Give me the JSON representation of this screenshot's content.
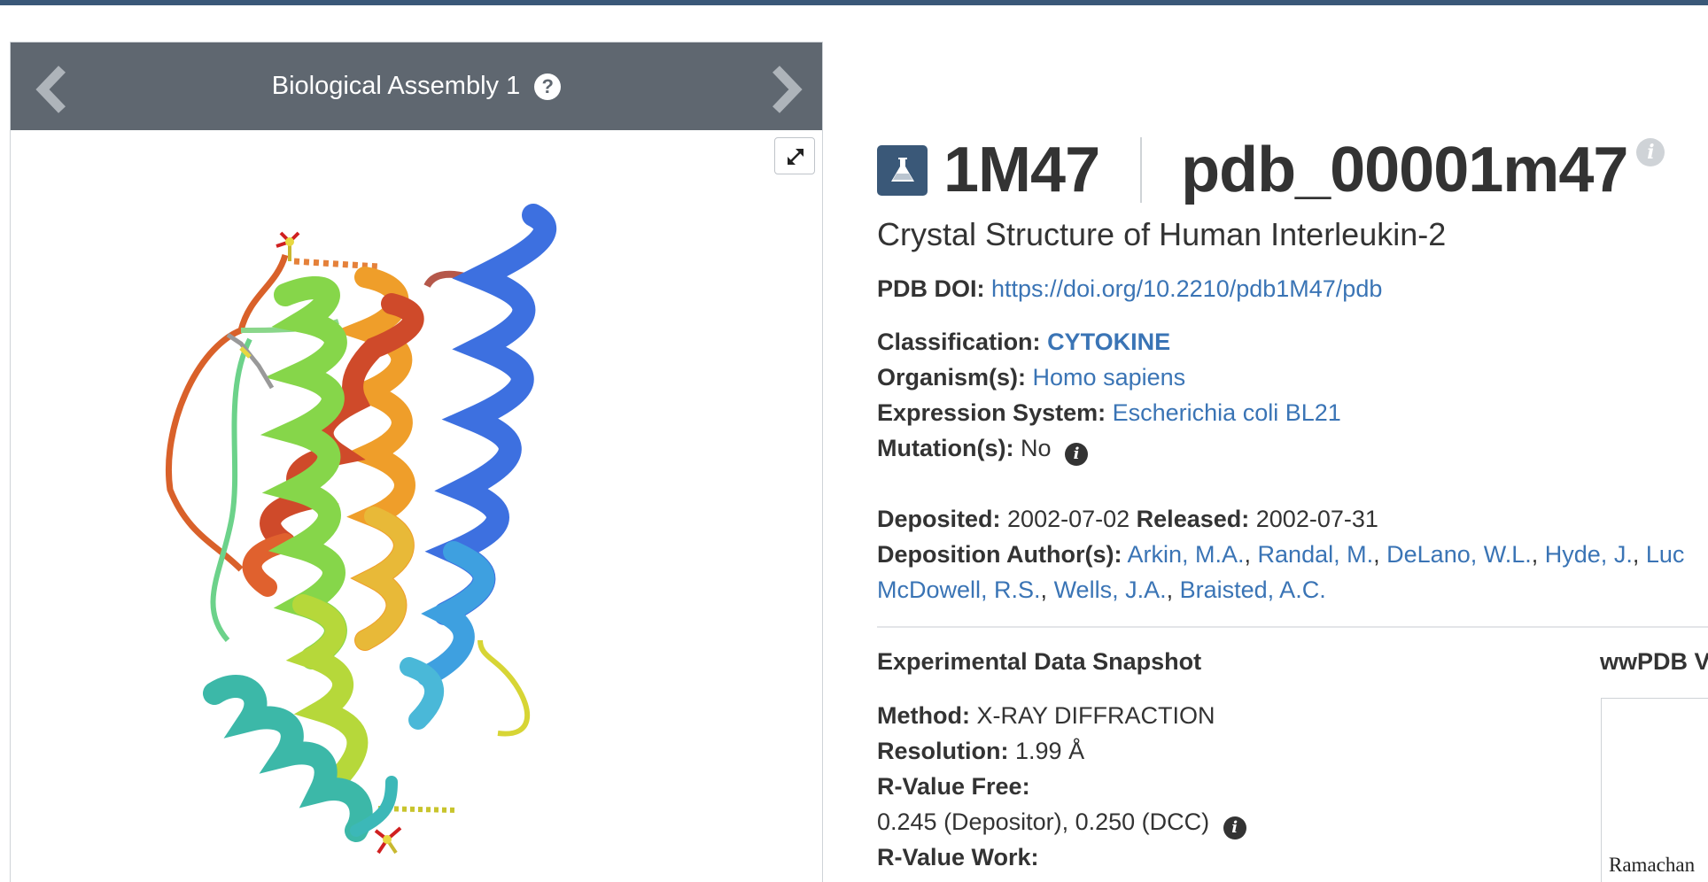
{
  "viewer": {
    "title": "Biological Assembly 1",
    "help_glyph": "?"
  },
  "entry": {
    "id": "1M47",
    "pdb_id": "pdb_00001m47",
    "title": "Crystal Structure of Human Interleukin-2",
    "info_glyph": "i"
  },
  "fields": {
    "doi_label": "PDB DOI:",
    "doi_value": "https://doi.org/10.2210/pdb1M47/pdb",
    "classification_label": "Classification:",
    "classification_value": "CYTOKINE",
    "organism_label": "Organism(s):",
    "organism_value": "Homo sapiens",
    "expression_label": "Expression System:",
    "expression_value": "Escherichia coli BL21",
    "mutation_label": "Mutation(s):",
    "mutation_value": "No",
    "deposited_label": "Deposited:",
    "deposited_value": "2002-07-02",
    "released_label": "Released:",
    "released_value": "2002-07-31",
    "authors_label": "Deposition Author(s):",
    "authors": [
      "Arkin, M.A.",
      "Randal, M.",
      "DeLano, W.L.",
      "Hyde, J.",
      "Luc",
      "McDowell, R.S.",
      "Wells, J.A.",
      "Braisted, A.C."
    ],
    "sep": ","
  },
  "experimental": {
    "title": "Experimental Data Snapshot",
    "method_label": "Method:",
    "method_value": "X-RAY DIFFRACTION",
    "resolution_label": "Resolution:",
    "resolution_value": "1.99 Å",
    "rfree_label": "R-Value Free:",
    "rfree_value": "0.245 (Depositor), 0.250 (DCC)",
    "rwork_label": "R-Value Work:"
  },
  "validation": {
    "title": "wwPDB V",
    "caption": "Ramachan"
  },
  "colors": {
    "header_bar": "#3a5878",
    "viewer_header": "#5f6770",
    "link": "#3a74b5"
  }
}
